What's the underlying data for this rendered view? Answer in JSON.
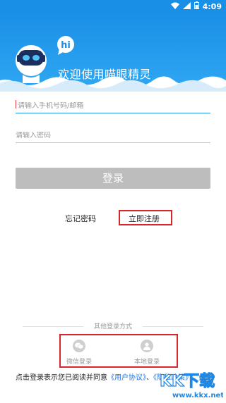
{
  "status_bar": {
    "time": "4:09"
  },
  "header": {
    "title": "欢迎使用喵眼精灵",
    "bubble_text": "hi"
  },
  "form": {
    "phone_placeholder": "请输入手机号码/邮箱",
    "password_placeholder": "请输入密码",
    "login_label": "登录"
  },
  "links": {
    "forgot": "忘记密码",
    "register": "立即注册"
  },
  "other_login": {
    "title": "其他登录方式",
    "options": [
      {
        "label": "微信登录",
        "icon": "wechat-icon"
      },
      {
        "label": "本地登录",
        "icon": "person-icon"
      }
    ]
  },
  "terms": {
    "prefix": "点击登录表示您已阅读并同意",
    "user_agreement": "《用户协议》",
    "separator": "、",
    "privacy_policy": "《隐私政策》"
  },
  "watermark": {
    "main": "KK下载",
    "url": "www.kkx.net"
  },
  "colors": {
    "brand_blue": "#1a8fe6",
    "highlight_red": "#d9262c",
    "button_gray": "#bdbdbd"
  }
}
